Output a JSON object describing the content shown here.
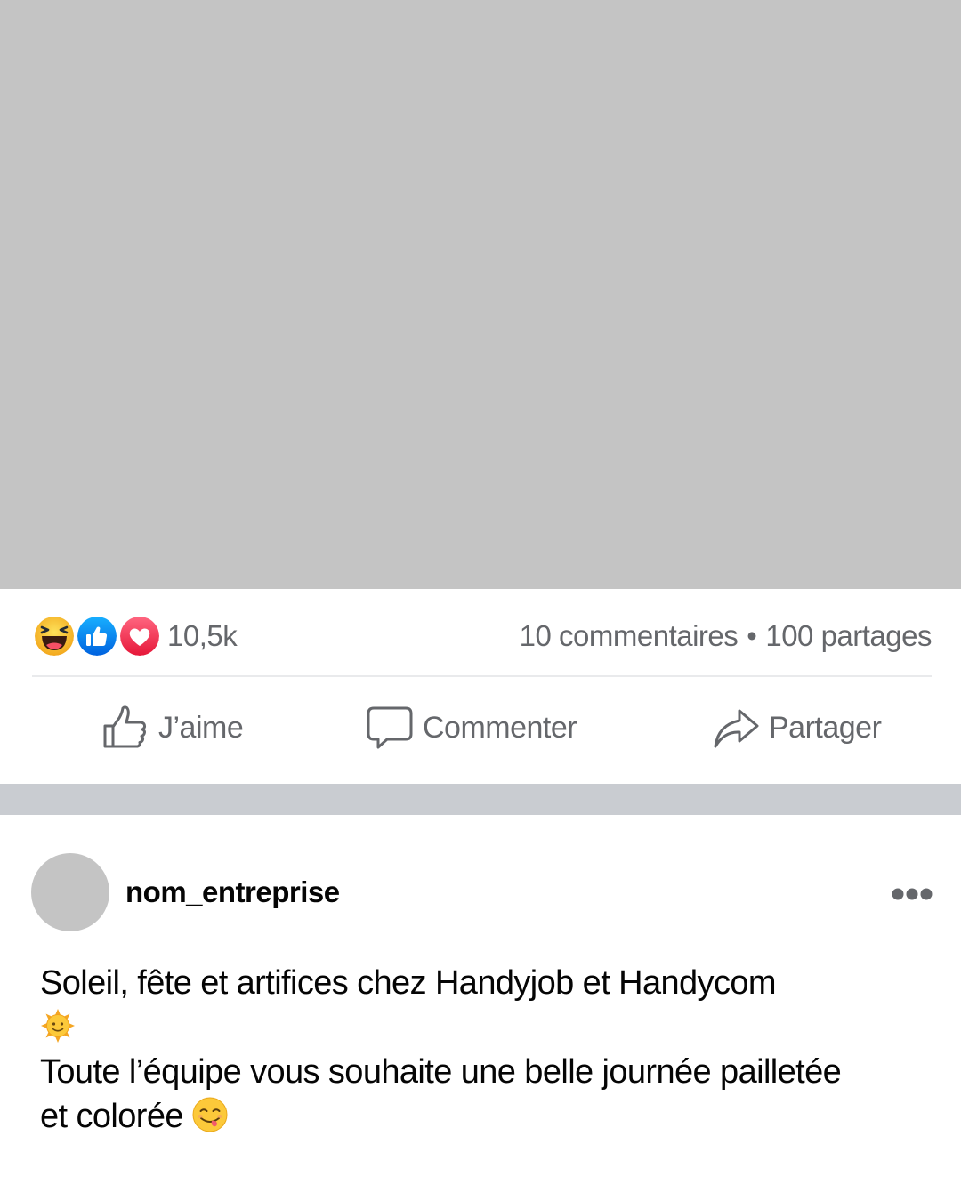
{
  "post": {
    "reactions": {
      "icons": [
        "haha-reaction-icon",
        "like-reaction-icon",
        "love-reaction-icon"
      ],
      "count": "10,5k"
    },
    "stats": {
      "comments": "10 commentaires",
      "separator": "•",
      "shares": "100 partages"
    },
    "actions": {
      "like_label": "J’aime",
      "comment_label": "Commenter",
      "share_label": "Partager"
    }
  },
  "next_post": {
    "author": "nom_entreprise",
    "text": {
      "line1": "Soleil, fête et artifices chez Handyjob et Handycom",
      "line1_emoji": "sun-with-face-emoji",
      "line2": "Toute l’équipe vous souhaite une belle journée pailletée",
      "line3": "et colorée",
      "line3_emoji": "yum-face-emoji"
    }
  },
  "colors": {
    "media_placeholder": "#c4c4c4",
    "secondary_text": "#65676b",
    "feed_separator": "#c9ccd1",
    "like_blue": "#1877f2",
    "love_red": "#f33e58",
    "haha_yellow": "#f7b125"
  }
}
